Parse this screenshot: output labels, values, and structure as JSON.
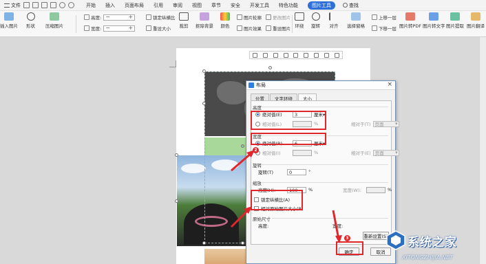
{
  "ribbon": {
    "file_menu": "文件",
    "tabs": [
      "开始",
      "插入",
      "页面布局",
      "引用",
      "审阅",
      "视图",
      "章节",
      "安全",
      "开发工具",
      "特色功能",
      "图片工具"
    ],
    "active_tab": "图片工具",
    "search_label": "查找"
  },
  "toolbar": {
    "insert_picture": "插入图片",
    "shape": "形状",
    "compress": "压缩图片",
    "height_label": "高度:",
    "width_label": "宽度:",
    "lock_ratio": "锁定纵横比",
    "reset_size": "重设大小",
    "crop": "裁剪",
    "remove_bg": "抠除背景",
    "color": "颜色",
    "effects": "图片效果",
    "outline": "图片轮廓",
    "change": "更改图片",
    "reset_pic": "重设图片",
    "wrap": "环绕",
    "rotate": "旋转",
    "align": "对齐",
    "select_pane": "选择窗格",
    "bring_forward": "上移一层",
    "send_backward": "下移一层",
    "to_pdf": "图片转PDF",
    "to_text": "图片转文字",
    "extract": "图片提取",
    "translate": "图片翻译"
  },
  "dialog": {
    "title": "布局",
    "close": "×",
    "tabs": [
      "位置",
      "文字环绕",
      "大小"
    ],
    "active_tab": "大小",
    "height_section": "高度",
    "absolute_label": "绝对值(E)",
    "height_value": "3",
    "unit_cm": "厘米▾",
    "relative_label": "相对值(L)",
    "percent": "%",
    "relative_to": "相对于(T)",
    "relative_to_value": "页面",
    "width_section": "宽度",
    "width_absolute_label": "绝对值(B)",
    "width_value": "6",
    "width_relative_label": "相对值(I)",
    "width_relative_to": "相对于(E)",
    "rotate_section": "旋转",
    "rotate_label": "旋转(T)",
    "rotate_value": "0",
    "degree": "°",
    "scale_section": "缩放",
    "scale_height_label": "高度(H):",
    "scale_height_value": "100",
    "scale_width_label": "宽度(W):",
    "lock_aspect": "锁定纵横比(A)",
    "relative_original": "相对原始图片大小(R)",
    "original_section": "原始尺寸",
    "orig_height": "高度:",
    "orig_width": "宽度:",
    "reset_button": "重新设置(S)",
    "ok_button": "确定",
    "cancel_button": "取消"
  },
  "annotations": {
    "badge1": "1",
    "badge2": "2",
    "badge3": "3"
  },
  "watermark": {
    "brand": "系统之家",
    "domain": "XITONGZHIJIA.NET"
  }
}
